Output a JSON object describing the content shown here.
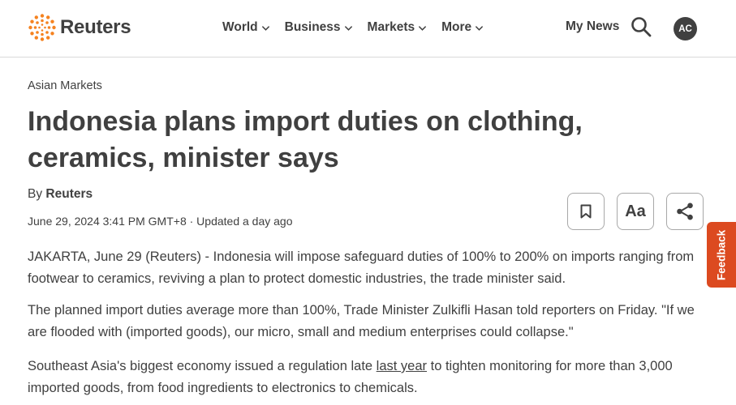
{
  "header": {
    "brand": "Reuters",
    "nav": [
      {
        "label": "World"
      },
      {
        "label": "Business"
      },
      {
        "label": "Markets"
      },
      {
        "label": "More"
      }
    ],
    "my_news": "My News",
    "avatar_initials": "AC"
  },
  "article": {
    "section": "Asian Markets",
    "title": "Indonesia plans import duties on clothing, ceramics, minister says",
    "byline_prefix": "By",
    "author": "Reuters",
    "date": "June 29, 2024 3:41 PM GMT+8 · Updated a day ago",
    "paragraphs": {
      "p1": "JAKARTA, June 29 (Reuters) - Indonesia will impose safeguard duties of 100% to 200% on imports ranging from footwear to ceramics, reviving a plan to protect domestic industries, the trade minister said.",
      "p2": "The planned import duties average more than 100%, Trade Minister Zulkifli Hasan told reporters on Friday. \"If we are flooded with (imported goods), our micro, small and medium enterprises could collapse.\"",
      "p3_before": "Southeast Asia's biggest economy issued a regulation late ",
      "p3_link": "last year",
      "p3_after": " to tighten monitoring for more than 3,000 imported goods, from food ingredients to electronics to chemicals."
    }
  },
  "tools": {
    "text_size_label": "Aa"
  },
  "feedback_label": "Feedback",
  "colors": {
    "text": "#404040",
    "feedback_bg": "#dc4a20",
    "logo_orange": "#f5821f"
  }
}
